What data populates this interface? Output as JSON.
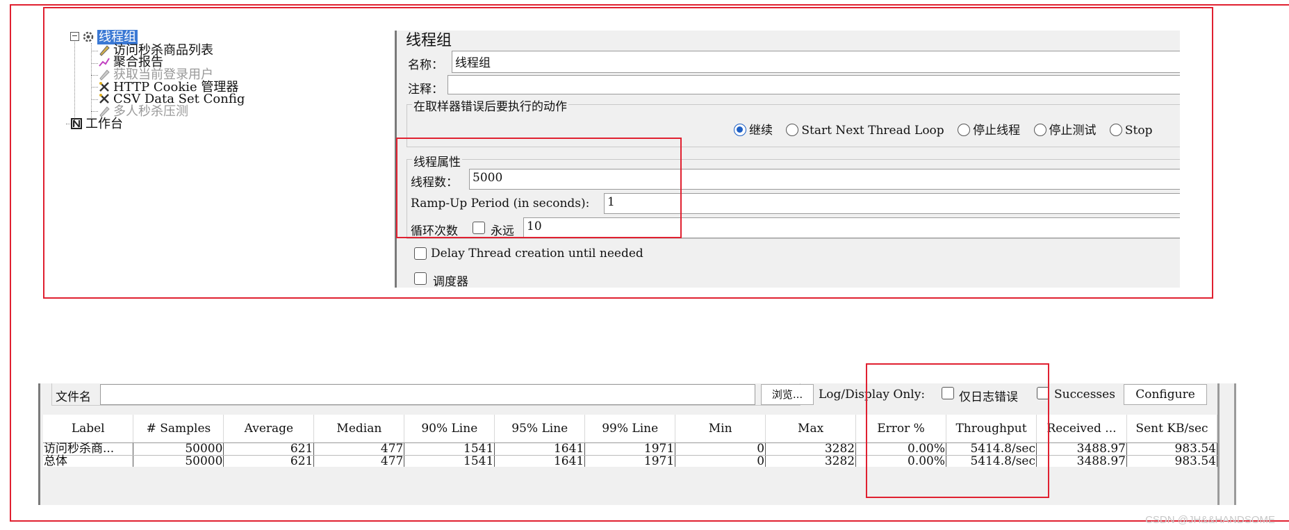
{
  "tree": {
    "thread_group": "线程组",
    "items": [
      {
        "label": "访问秒杀商品列表",
        "icon": "pencil-icon",
        "disabled": false
      },
      {
        "label": "聚合报告",
        "icon": "report-chart-icon",
        "disabled": false
      },
      {
        "label": "获取当前登录用户",
        "icon": "pencil-icon",
        "disabled": true
      },
      {
        "label": "HTTP Cookie 管理器",
        "icon": "wrench-icon",
        "disabled": false
      },
      {
        "label": "CSV Data Set Config",
        "icon": "wrench-icon",
        "disabled": false
      },
      {
        "label": "多人秒杀压测",
        "icon": "pencil-icon",
        "disabled": true
      }
    ],
    "workbench": "工作台"
  },
  "panel": {
    "title": "线程组",
    "name_label": "名称：",
    "name_value": "线程组",
    "comment_label": "注释：",
    "comment_value": "",
    "error_action_legend": "在取样器错误后要执行的动作",
    "error_actions": [
      {
        "label": "继续",
        "selected": true
      },
      {
        "label": "Start Next Thread Loop",
        "selected": false
      },
      {
        "label": "停止线程",
        "selected": false
      },
      {
        "label": "停止测试",
        "selected": false
      },
      {
        "label": "Stop",
        "selected": false
      }
    ],
    "thread_props_legend": "线程属性",
    "threads_label": "线程数：",
    "threads_value": "5000",
    "rampup_label": "Ramp-Up Period (in seconds):",
    "rampup_value": "1",
    "loop_label": "循环次数",
    "forever_label": "永远",
    "loop_value": "10",
    "delay_label": "Delay Thread creation until needed",
    "scheduler_label": "调度器"
  },
  "results": {
    "filename_label": "文件名",
    "filename_value": "",
    "browse_label": "浏览...",
    "log_display_label": "Log/Display Only:",
    "errors_only_label": "仅日志错误",
    "successes_label": "Successes",
    "configure_label": "Configure",
    "columns": [
      "Label",
      "# Samples",
      "Average",
      "Median",
      "90% Line",
      "95% Line",
      "99% Line",
      "Min",
      "Max",
      "Error %",
      "Throughput",
      "Received ...",
      "Sent KB/sec"
    ],
    "rows": [
      [
        "访问秒杀商...",
        "50000",
        "621",
        "477",
        "1541",
        "1641",
        "1971",
        "0",
        "3282",
        "0.00%",
        "5414.8/sec",
        "3488.97",
        "983.54"
      ],
      [
        "总体",
        "50000",
        "621",
        "477",
        "1541",
        "1641",
        "1971",
        "0",
        "3282",
        "0.00%",
        "5414.8/sec",
        "3488.97",
        "983.54"
      ]
    ]
  },
  "watermark": "CSDN @JH&&HANDSOME",
  "colors": {
    "highlight_box": "#e02030",
    "selection": "#3a78d4",
    "radio_selected": "#1d5fc4"
  }
}
